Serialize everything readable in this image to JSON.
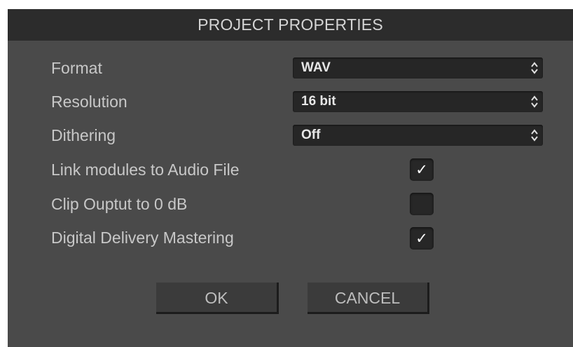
{
  "dialog": {
    "title": "PROJECT PROPERTIES"
  },
  "fields": {
    "format": {
      "label": "Format",
      "value": "WAV"
    },
    "resolution": {
      "label": "Resolution",
      "value": "16 bit"
    },
    "dithering": {
      "label": "Dithering",
      "value": "Off"
    }
  },
  "checkboxes": {
    "link_modules": {
      "label": "Link modules to Audio File",
      "checked": true,
      "mark": "✓"
    },
    "clip_output": {
      "label": "Clip Ouptut to 0 dB",
      "checked": false,
      "mark": ""
    },
    "digital_delivery": {
      "label": "Digital Delivery Mastering",
      "checked": true,
      "mark": "✓"
    }
  },
  "buttons": {
    "ok": "OK",
    "cancel": "CANCEL"
  },
  "colors": {
    "dialog_bg": "#4a4a4a",
    "titlebar_bg": "#2c2c2c",
    "control_bg": "#262626",
    "text": "#c8c8c8"
  },
  "icons": {
    "select_arrows": "updown-chevron-icon",
    "check": "checkmark-icon"
  }
}
